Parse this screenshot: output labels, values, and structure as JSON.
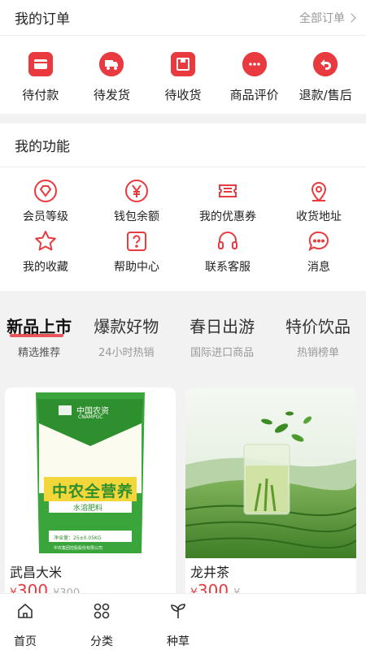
{
  "orders": {
    "title": "我的订单",
    "all_label": "全部订单",
    "items": [
      {
        "label": "待付款",
        "icon": "wallet-icon"
      },
      {
        "label": "待发货",
        "icon": "truck-icon"
      },
      {
        "label": "待收货",
        "icon": "package-icon"
      },
      {
        "label": "商品评价",
        "icon": "comment-icon"
      },
      {
        "label": "退款/售后",
        "icon": "return-icon"
      }
    ]
  },
  "functions": {
    "title": "我的功能",
    "items": [
      {
        "label": "会员等级",
        "icon": "diamond-icon"
      },
      {
        "label": "钱包余额",
        "icon": "yuan-icon"
      },
      {
        "label": "我的优惠券",
        "icon": "coupon-icon"
      },
      {
        "label": "收货地址",
        "icon": "location-icon"
      },
      {
        "label": "我的收藏",
        "icon": "star-icon"
      },
      {
        "label": "帮助中心",
        "icon": "help-icon"
      },
      {
        "label": "联系客服",
        "icon": "headset-icon"
      },
      {
        "label": "消息",
        "icon": "message-icon"
      }
    ]
  },
  "tabs": [
    {
      "title": "新品上市",
      "sub": "精选推荐",
      "active": true
    },
    {
      "title": "爆款好物",
      "sub": "24小时热销",
      "active": false
    },
    {
      "title": "春日出游",
      "sub": "国际进口商品",
      "active": false
    },
    {
      "title": "特价饮品",
      "sub": "热销榜单",
      "active": false
    }
  ],
  "products": [
    {
      "name": "武昌大米",
      "price_symbol": "¥",
      "price": "300",
      "old_price": "¥300",
      "image_text": {
        "brand": "中国农资",
        "brand_en": "CNAMPGC",
        "product": "中农全营养",
        "type": "水溶肥料",
        "net": "净含量：25±0.05KG",
        "maker": "中农集团控股股份有限公司"
      }
    },
    {
      "name": "龙井茶",
      "price_symbol": "¥",
      "price": "300",
      "old_price": "¥"
    }
  ],
  "nav": [
    {
      "label": "首页",
      "icon": "home-icon"
    },
    {
      "label": "分类",
      "icon": "grid-icon"
    },
    {
      "label": "种草",
      "icon": "sprout-icon"
    }
  ],
  "colors": {
    "accent": "#e83a3f",
    "background": "#f2f2f2"
  }
}
